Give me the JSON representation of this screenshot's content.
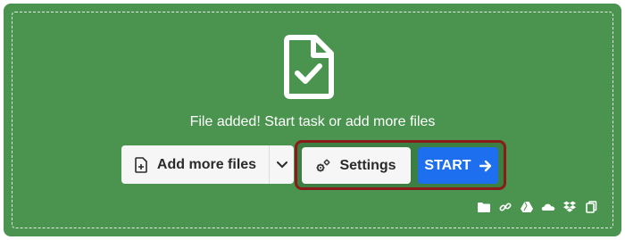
{
  "status_message": "File added! Start task or add more files",
  "buttons": {
    "add_more_label": "Add more files",
    "settings_label": "Settings",
    "start_label": "START"
  },
  "sources": [
    "folder-icon",
    "link-icon",
    "google-drive-icon",
    "onedrive-icon",
    "dropbox-icon",
    "clipboard-icon"
  ],
  "colors": {
    "dropzone_bg": "#4a944f",
    "start_bg": "#1e6ef0",
    "highlight_border": "#8b1a1a",
    "button_bg": "#f6f6f6"
  }
}
